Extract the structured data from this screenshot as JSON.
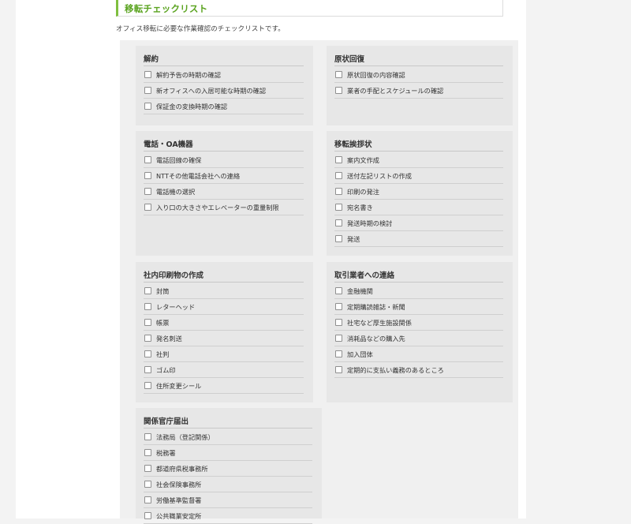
{
  "section": {
    "title": "移転チェックリスト",
    "intro": "オフィス移転に必要な作業確認のチェックリストです。"
  },
  "cards": [
    {
      "title": "解約",
      "items": [
        "解約予告の時期の確認",
        "新オフィスへの入居可能な時期の確認",
        "保証金の変換時期の確認"
      ]
    },
    {
      "title": "原状回復",
      "items": [
        "原状回復の内容確認",
        "業者の手配とスケジュールの確認"
      ]
    },
    {
      "title": "電話・OA機器",
      "items": [
        "電話回線の確保",
        "NTTその他電話会社への連絡",
        "電話機の選択",
        "入り口の大きさやエレベーターの重量制限"
      ]
    },
    {
      "title": "移転挨拶状",
      "items": [
        "案内文作成",
        "送付左記リストの作成",
        "印刷の発注",
        "宛名書き",
        "発送時期の検討",
        "発送"
      ]
    },
    {
      "title": "社内印刷物の作成",
      "items": [
        "封筒",
        "レターヘッド",
        "帳票",
        "発名刺送",
        "社判",
        "ゴム印",
        "住所変更シール"
      ]
    },
    {
      "title": "取引業者への連絡",
      "items": [
        "金融機関",
        "定期購読雑誌・新聞",
        "社宅など厚生施設関係",
        "消耗品などの購入先",
        "加入団体",
        "定期的に支払い義務のあるところ"
      ]
    },
    {
      "title": "関係官庁届出",
      "items": [
        "法務局（登記関係）",
        "税務署",
        "都道府県税事務所",
        "社会保険事務所",
        "労働基準監督署",
        "公共職業安定所"
      ]
    }
  ]
}
